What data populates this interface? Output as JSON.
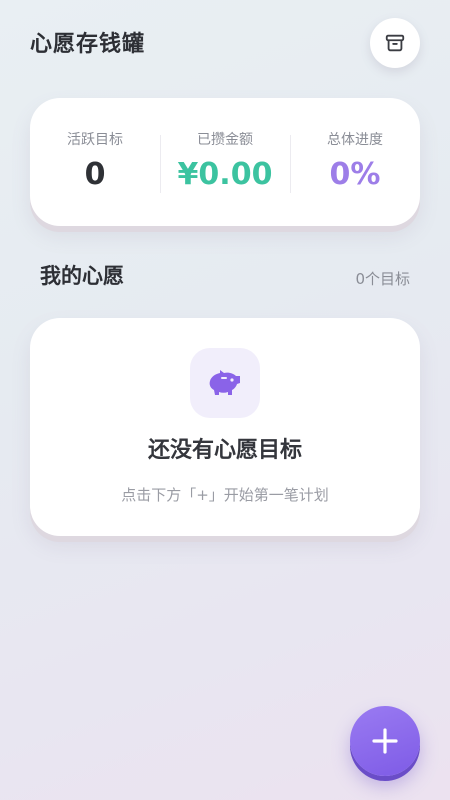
{
  "header": {
    "title": "心愿存钱罐",
    "archive_icon": "archive-box-icon"
  },
  "stats": {
    "active_goals": {
      "label": "活跃目标",
      "value": "0",
      "color": "#2f3136"
    },
    "saved_amount": {
      "label": "已攒金额",
      "value": "¥0.00",
      "color": "#3cc3a0"
    },
    "overall_progress": {
      "label": "总体进度",
      "value": "0%",
      "color": "#9d7ee8"
    }
  },
  "wishes": {
    "title": "我的心愿",
    "count": "0个目标"
  },
  "empty_state": {
    "icon": "piggy-bank-icon",
    "title": "还没有心愿目标",
    "hint": "点击下方「+」开始第一笔计划"
  },
  "fab": {
    "icon": "plus-icon",
    "color": "#8a66ee"
  }
}
